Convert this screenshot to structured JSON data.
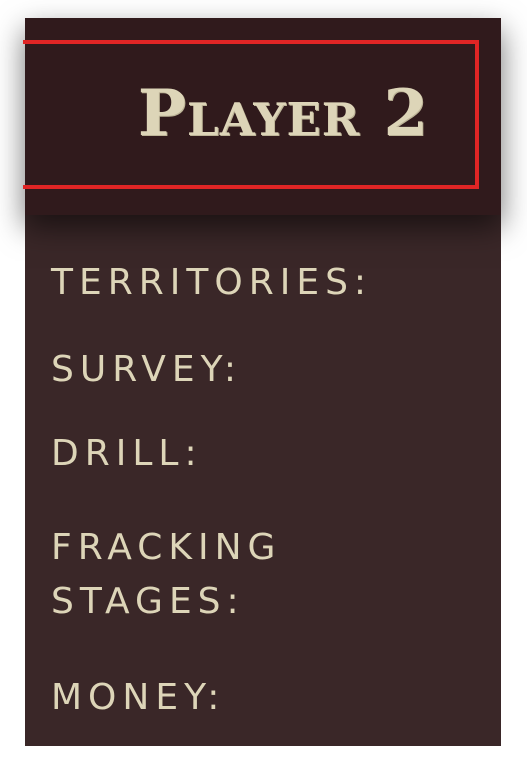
{
  "player": {
    "title": "Player 2"
  },
  "stats": {
    "territories_label": "TERRITORIES:",
    "survey_label": "SURVEY:",
    "drill_label": "DRILL:",
    "fracking_label_line1": "FRACKING",
    "fracking_label_line2": "STAGES:",
    "money_label": "MONEY:"
  },
  "colors": {
    "panel_background": "#3a2728",
    "header_background": "#301a1c",
    "header_border": "#e02525",
    "text": "#ddd5b8"
  }
}
